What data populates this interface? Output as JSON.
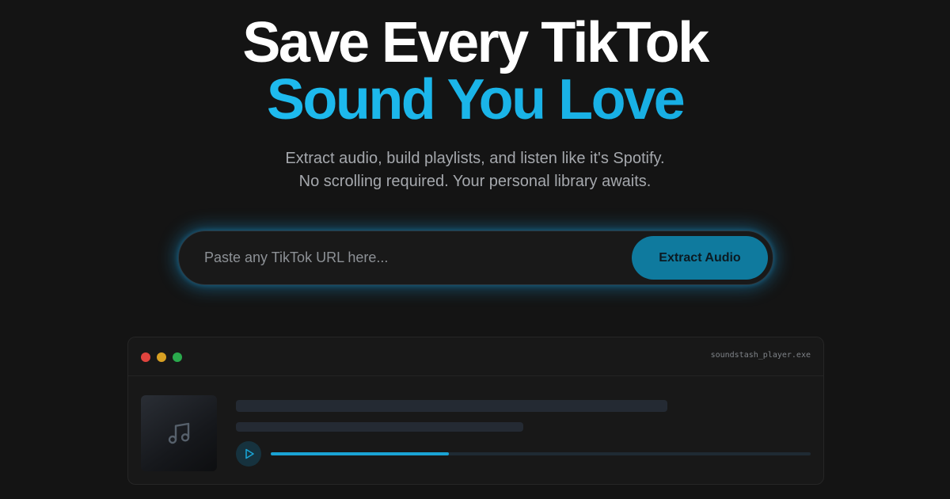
{
  "hero": {
    "title_line1": "Save Every TikTok",
    "title_line2": "Sound You Love",
    "subtitle_line1": "Extract audio, build playlists, and listen like it's Spotify.",
    "subtitle_line2": "No scrolling required. Your personal library awaits."
  },
  "url_bar": {
    "placeholder": "Paste any TikTok URL here...",
    "value": "",
    "button_label": "Extract Audio"
  },
  "player": {
    "window_title": "soundstash_player.exe",
    "album_icon": "music-note-icon",
    "play_icon": "play-icon",
    "progress": 0.33
  },
  "colors": {
    "background": "#141414",
    "accent": "#1bb5e8",
    "button": "#0f7a9e",
    "dot_red": "#e0443e",
    "dot_yellow": "#d8a023",
    "dot_green": "#2aa94c"
  }
}
